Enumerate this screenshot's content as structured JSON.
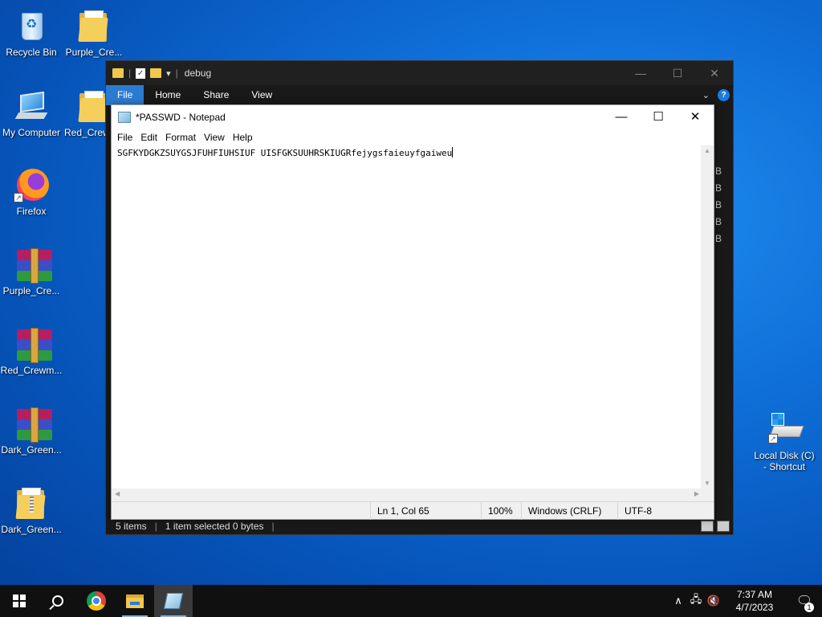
{
  "desktop": {
    "icons": [
      {
        "label": "Recycle Bin"
      },
      {
        "label": "Purple_Cre..."
      },
      {
        "label": "My Computer"
      },
      {
        "label": "Red_Crew"
      },
      {
        "label": "Firefox"
      },
      {
        "label": "Purple_Cre..."
      },
      {
        "label": "Red_Crewm..."
      },
      {
        "label": "Dark_Green..."
      },
      {
        "label": "Dark_Green..."
      },
      {
        "label": "Local Disk (C)\n- Shortcut"
      }
    ]
  },
  "explorer": {
    "title": "debug",
    "tabs": [
      "File",
      "Home",
      "Share",
      "View"
    ],
    "side_letters": [
      "B",
      "B",
      "B",
      "B",
      "B"
    ],
    "status": {
      "items": "5 items",
      "selected": "1 item selected  0 bytes"
    }
  },
  "notepad": {
    "title": "*PASSWD - Notepad",
    "menu": [
      "File",
      "Edit",
      "Format",
      "View",
      "Help"
    ],
    "content": "SGFKYDGKZSUYGSJFUHFIUHSIUF UISFGKSUUHRSKIUGRfejygsfaieuyfgaiweu",
    "status": {
      "position": "Ln 1, Col 65",
      "zoom": "100%",
      "line_ending": "Windows (CRLF)",
      "encoding": "UTF-8"
    }
  },
  "taskbar": {
    "time": "7:37 AM",
    "date": "4/7/2023",
    "notifications": "1"
  }
}
